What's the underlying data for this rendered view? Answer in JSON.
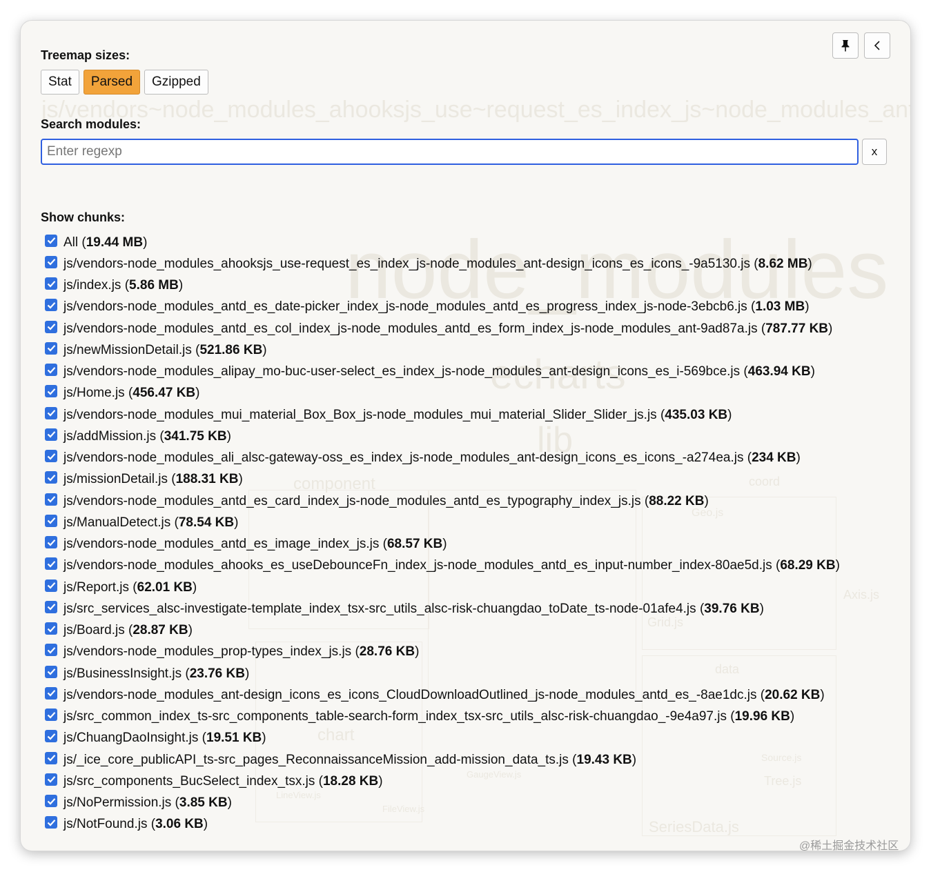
{
  "sidebar": {
    "treemap_label": "Treemap sizes:",
    "size_options": [
      {
        "label": "Stat",
        "active": false
      },
      {
        "label": "Parsed",
        "active": true
      },
      {
        "label": "Gzipped",
        "active": false
      }
    ],
    "search_label": "Search modules:",
    "search_placeholder": "Enter regexp",
    "clear_label": "x",
    "chunks_label": "Show chunks:",
    "chunks": [
      {
        "name": "All",
        "size": "19.44 MB"
      },
      {
        "name": "js/vendors-node_modules_ahooksjs_use-request_es_index_js-node_modules_ant-design_icons_es_icons_-9a5130.js",
        "size": "8.62 MB"
      },
      {
        "name": "js/index.js",
        "size": "5.86 MB"
      },
      {
        "name": "js/vendors-node_modules_antd_es_date-picker_index_js-node_modules_antd_es_progress_index_js-node-3ebcb6.js",
        "size": "1.03 MB"
      },
      {
        "name": "js/vendors-node_modules_antd_es_col_index_js-node_modules_antd_es_form_index_js-node_modules_ant-9ad87a.js",
        "size": "787.77 KB"
      },
      {
        "name": "js/newMissionDetail.js",
        "size": "521.86 KB"
      },
      {
        "name": "js/vendors-node_modules_alipay_mo-buc-user-select_es_index_js-node_modules_ant-design_icons_es_i-569bce.js",
        "size": "463.94 KB"
      },
      {
        "name": "js/Home.js",
        "size": "456.47 KB"
      },
      {
        "name": "js/vendors-node_modules_mui_material_Box_Box_js-node_modules_mui_material_Slider_Slider_js.js",
        "size": "435.03 KB"
      },
      {
        "name": "js/addMission.js",
        "size": "341.75 KB"
      },
      {
        "name": "js/vendors-node_modules_ali_alsc-gateway-oss_es_index_js-node_modules_ant-design_icons_es_icons_-a274ea.js",
        "size": "234 KB"
      },
      {
        "name": "js/missionDetail.js",
        "size": "188.31 KB"
      },
      {
        "name": "js/vendors-node_modules_antd_es_card_index_js-node_modules_antd_es_typography_index_js.js",
        "size": "88.22 KB"
      },
      {
        "name": "js/ManualDetect.js",
        "size": "78.54 KB"
      },
      {
        "name": "js/vendors-node_modules_antd_es_image_index_js.js",
        "size": "68.57 KB"
      },
      {
        "name": "js/vendors-node_modules_ahooks_es_useDebounceFn_index_js-node_modules_antd_es_input-number_index-80ae5d.js",
        "size": "68.29 KB"
      },
      {
        "name": "js/Report.js",
        "size": "62.01 KB"
      },
      {
        "name": "js/src_services_alsc-investigate-template_index_tsx-src_utils_alsc-risk-chuangdao_toDate_ts-node-01afe4.js",
        "size": "39.76 KB"
      },
      {
        "name": "js/Board.js",
        "size": "28.87 KB"
      },
      {
        "name": "js/vendors-node_modules_prop-types_index_js.js",
        "size": "28.76 KB"
      },
      {
        "name": "js/BusinessInsight.js",
        "size": "23.76 KB"
      },
      {
        "name": "js/vendors-node_modules_ant-design_icons_es_icons_CloudDownloadOutlined_js-node_modules_antd_es_-8ae1dc.js",
        "size": "20.62 KB"
      },
      {
        "name": "js/src_common_index_ts-src_components_table-search-form_index_tsx-src_utils_alsc-risk-chuangdao_-9e4a97.js",
        "size": "19.96 KB"
      },
      {
        "name": "js/ChuangDaoInsight.js",
        "size": "19.51 KB"
      },
      {
        "name": "js/_ice_core_publicAPI_ts-src_pages_ReconnaissanceMission_add-mission_data_ts.js",
        "size": "19.43 KB"
      },
      {
        "name": "js/src_components_BucSelect_index_tsx.js",
        "size": "18.28 KB"
      },
      {
        "name": "js/NoPermission.js",
        "size": "3.85 KB"
      },
      {
        "name": "js/NotFound.js",
        "size": "3.06 KB"
      }
    ]
  },
  "icons": {
    "pin": "pin-icon",
    "collapse": "chevron-left-icon",
    "checkbox": "checkmark-icon"
  },
  "colors": {
    "active_button": "#f2a33a",
    "checkbox": "#2f6fde",
    "search_border": "#2f5fe0"
  },
  "background_treemap": {
    "labels": [
      "js/vendors~node_modules_ahooksjs_use~request_es_index_js~node_modules_ant~d",
      "node_modules",
      "echarts",
      "lib",
      "component",
      "coord",
      "Geo.js",
      "Axis.js",
      "Grid.js",
      "data",
      "chart",
      "Tree.js",
      "SeriesData.js",
      "Source.js",
      "LineView.js",
      "FileView.js",
      "GaugeView.js"
    ]
  },
  "watermark": "@稀土掘金技术社区"
}
